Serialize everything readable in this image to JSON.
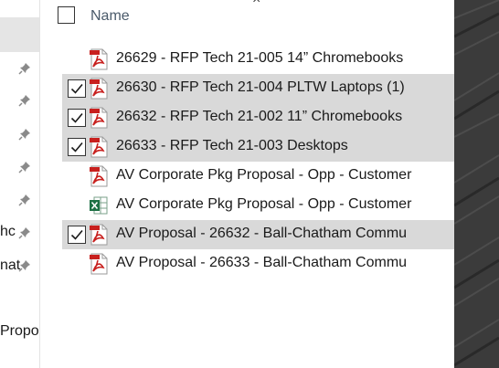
{
  "nav": {
    "labels": [
      "hc",
      "nat",
      "Propo"
    ],
    "pin_count": 7
  },
  "header": {
    "name_label": "Name",
    "close_glyph": "×"
  },
  "files": [
    {
      "name": "26629 - RFP Tech 21-005 14” Chromebooks",
      "icon": "pdf-icon",
      "selected": false
    },
    {
      "name": "26630 - RFP Tech 21-004 PLTW Laptops (1)",
      "icon": "pdf-icon",
      "selected": true
    },
    {
      "name": "26632 - RFP Tech 21-002 11” Chromebooks",
      "icon": "pdf-icon",
      "selected": true
    },
    {
      "name": "26633 - RFP Tech 21-003 Desktops",
      "icon": "pdf-icon",
      "selected": true
    },
    {
      "name": "AV Corporate Pkg Proposal - Opp - Customer",
      "icon": "pdf-icon",
      "selected": false
    },
    {
      "name": "AV Corporate Pkg Proposal - Opp - Customer",
      "icon": "excel-icon",
      "selected": false
    },
    {
      "name": "AV Proposal - 26632 - Ball-Chatham Commu",
      "icon": "pdf-icon",
      "selected": true
    },
    {
      "name": "AV Proposal - 26633 - Ball-Chatham Commu",
      "icon": "pdf-icon",
      "selected": false
    }
  ],
  "colors": {
    "selected_row": "#d9d9d9",
    "pdf_red": "#c8201e",
    "excel_green": "#1d7044",
    "header_text": "#4a5a6a"
  }
}
